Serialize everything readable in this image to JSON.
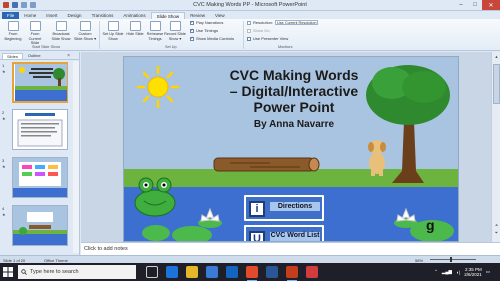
{
  "window": {
    "title": "CVC Making Words PP  -  Microsoft PowerPoint"
  },
  "ribbon_tabs": [
    {
      "label": "File"
    },
    {
      "label": "Home"
    },
    {
      "label": "Insert"
    },
    {
      "label": "Design"
    },
    {
      "label": "Transitions"
    },
    {
      "label": "Animations"
    },
    {
      "label": "Slide Show"
    },
    {
      "label": "Review"
    },
    {
      "label": "View"
    }
  ],
  "ribbon": {
    "from_beginning": "From Beginning",
    "from_current": "From Current Slide",
    "broadcast": "Broadcast Slide Show",
    "custom_show": "Custom Slide Show ▾",
    "group_start": "Start Slide Show",
    "set_up": "Set Up Slide Show",
    "hide_slide": "Hide Slide",
    "rehearse": "Rehearse Timings",
    "record": "Record Slide Show ▾",
    "group_setup": "Set Up",
    "play_narrations": "Play Narrations",
    "use_timings": "Use Timings",
    "show_media_controls": "Show Media Controls",
    "resolution_label": "Resolution:",
    "resolution_value": "Use Current Resolution",
    "show_on_label": "Show On:",
    "use_presenter_view": "Use Presenter View",
    "group_monitors": "Monitors"
  },
  "pane": {
    "tab_slides": "Slides",
    "tab_outline": "Outline",
    "close": "×"
  },
  "thumbnails": [
    {
      "num": "1",
      "star": "★"
    },
    {
      "num": "2",
      "star": "★"
    },
    {
      "num": "3",
      "star": "★"
    },
    {
      "num": "4",
      "star": "★"
    }
  ],
  "slide": {
    "title_line1": "CVC Making Words",
    "title_line2": "– Digital/Interactive",
    "title_line3": "Power Point",
    "author": "By Anna Navarre",
    "directions_label": "Directions",
    "directions_icon": "i",
    "wordlist_label": "CVC Word List",
    "wordlist_icon": "U",
    "lilypad_letter": "g"
  },
  "notes": {
    "placeholder": "Click to add notes"
  },
  "status": {
    "slide_info": "Slide 1 of 20",
    "theme": "Office Theme",
    "zoom": "58%"
  },
  "taskbar": {
    "search_placeholder": "Type here to search",
    "time": "2:35 PM",
    "date": "2/6/2021"
  },
  "colors": {
    "sky": "#a9c4e1",
    "grass": "#6db33f",
    "pond": "#3d6fd0",
    "accent": "#2a66b2"
  }
}
